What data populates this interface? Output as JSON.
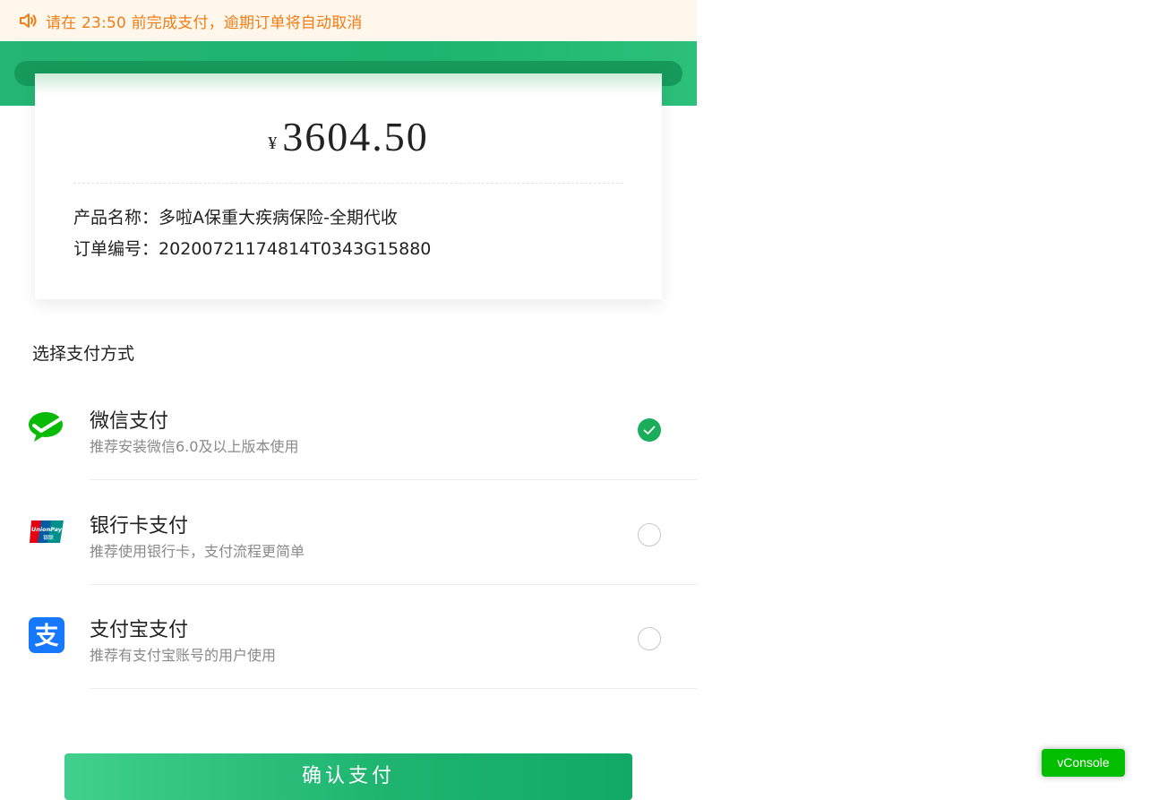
{
  "notice": {
    "text": "请在 23:50 前完成支付，逾期订单将自动取消",
    "icon": "speaker-icon"
  },
  "order": {
    "currency_symbol": "¥",
    "amount": "3604.50",
    "product_label": "产品名称：",
    "product_name": "多啦A保重大疾病保险-全期代收",
    "order_no_label": "订单编号：",
    "order_no": "20200721174814T0343G15880"
  },
  "payment": {
    "section_title": "选择支付方式",
    "methods": [
      {
        "name": "微信支付",
        "desc": "推荐安装微信6.0及以上版本使用",
        "icon": "wechat-pay-icon",
        "selected": true
      },
      {
        "name": "银行卡支付",
        "desc": "推荐使用银行卡，支付流程更简单",
        "icon": "unionpay-icon",
        "icon_text_top": "UnionPay",
        "icon_text_bottom": "银联",
        "selected": false
      },
      {
        "name": "支付宝支付",
        "desc": "推荐有支付宝账号的用户使用",
        "icon": "alipay-icon",
        "icon_text": "支",
        "selected": false
      }
    ]
  },
  "submit_button": {
    "label": "确认支付"
  },
  "vconsole": {
    "label": "vConsole"
  },
  "colors": {
    "notice_text": "#f07d16",
    "notice_bg": "#fff7eb",
    "brand_green": "#1cb470",
    "check_green": "#1aad5a",
    "wechat_green": "#09bb07",
    "alipay_blue": "#1677ff",
    "unionpay_red": "#e60012",
    "unionpay_blue": "#005ba2",
    "unionpay_teal": "#00908c",
    "vconsole_green": "#04be02"
  }
}
